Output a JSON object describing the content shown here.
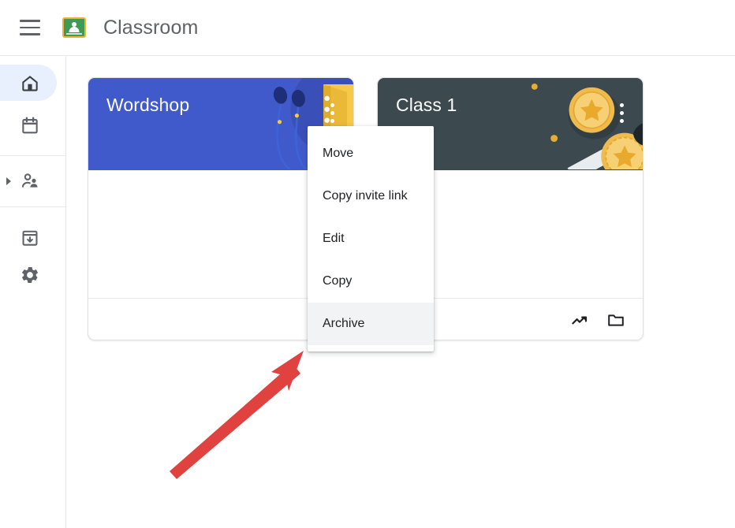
{
  "app": {
    "title": "Classroom",
    "logo_icon": "classroom-logo-icon",
    "menu_icon": "hamburger-menu-icon"
  },
  "sidebar": {
    "items": [
      {
        "label": "Home",
        "icon": "home-icon",
        "active": true
      },
      {
        "label": "Calendar",
        "icon": "calendar-icon",
        "active": false
      },
      {
        "label": "Teaching",
        "icon": "people-icon",
        "active": false,
        "expandable": true,
        "expand_icon": "chevron-right-icon"
      },
      {
        "label": "Archived classes",
        "icon": "archive-icon",
        "active": false
      },
      {
        "label": "Settings",
        "icon": "gear-icon",
        "active": false
      }
    ]
  },
  "cards": [
    {
      "title": "Wordshop",
      "theme_color": "#4059cb",
      "art": "earbuds-and-notebook-illustration",
      "kebab_icon": "more-options-icon",
      "footer_icons": [
        "open-class-icon"
      ]
    },
    {
      "title": "Class 1",
      "theme_color": "#3c4a50",
      "art": "gold-medals-illustration",
      "kebab_icon": "more-options-icon",
      "footer_icons": [
        "open-class-icon",
        "folder-icon"
      ]
    }
  ],
  "context_menu": {
    "items": [
      {
        "label": "Move",
        "hovered": false
      },
      {
        "label": "Copy invite link",
        "hovered": false
      },
      {
        "label": "Edit",
        "hovered": false
      },
      {
        "label": "Copy",
        "hovered": false
      },
      {
        "label": "Archive",
        "hovered": true
      }
    ]
  },
  "annotation": {
    "type": "arrow",
    "color": "#e04240",
    "points_to": "Archive"
  }
}
